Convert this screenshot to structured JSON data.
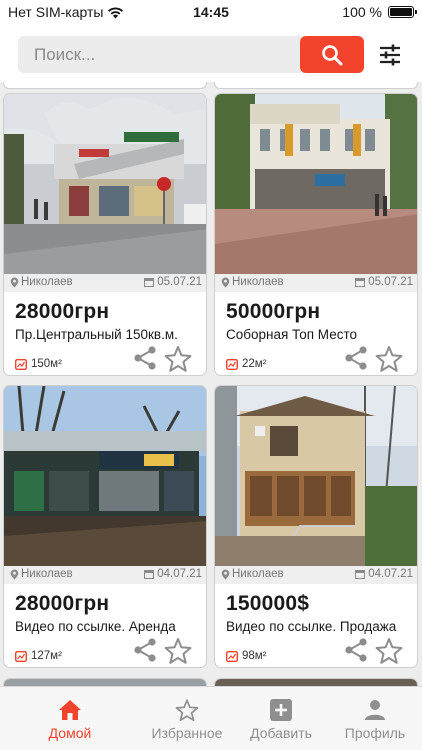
{
  "status": {
    "carrier": "Нет SIM-карты",
    "time": "14:45",
    "battery_percent": "100 %",
    "battery_level": 1.0
  },
  "search": {
    "placeholder": "Поиск..."
  },
  "listings": [
    {
      "city": "Николаев",
      "date": "05.07.21",
      "price": "28000грн",
      "title": "Пр.Центральный 150кв.м.",
      "area": "150м²"
    },
    {
      "city": "Николаев",
      "date": "05.07.21",
      "price": "50000грн",
      "title": "Соборная Топ Место",
      "area": "22м²"
    },
    {
      "city": "Николаев",
      "date": "04.07.21",
      "price": "28000грн",
      "title": "Видео по ссылке. Аренда",
      "area": "127м²"
    },
    {
      "city": "Николаев",
      "date": "04.07.21",
      "price": "150000$",
      "title": "Видео по ссылке. Продажа",
      "area": "98м²"
    }
  ],
  "tabs": [
    {
      "label": "Домой",
      "icon": "home-icon",
      "active": true
    },
    {
      "label": "Избранное",
      "icon": "star-icon",
      "active": false
    },
    {
      "label": "Добавить",
      "icon": "add-icon",
      "active": false
    },
    {
      "label": "Профиль",
      "icon": "profile-icon",
      "active": false
    }
  ],
  "colors": {
    "accent": "#f4432c",
    "inactive": "#8f8f8f",
    "meta_background": "#efefef"
  }
}
